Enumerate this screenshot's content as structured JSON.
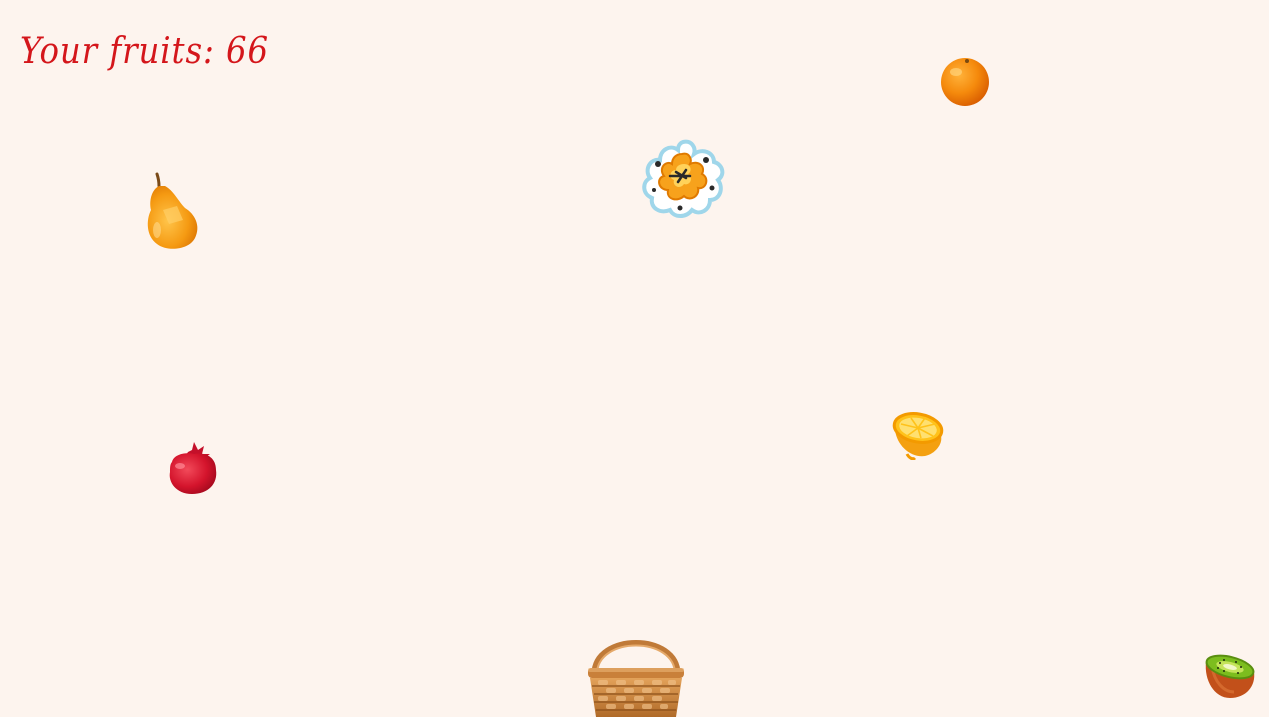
{
  "hud": {
    "score_label": "Your fruits:",
    "score_value": "66"
  },
  "sprites": [
    {
      "name": "orange-icon"
    },
    {
      "name": "pear-icon"
    },
    {
      "name": "explosion-icon"
    },
    {
      "name": "pomegranate-icon"
    },
    {
      "name": "lemon-half-icon"
    },
    {
      "name": "basket-icon"
    },
    {
      "name": "kiwi-half-icon"
    }
  ],
  "colors": {
    "background": "#fdf4ee",
    "score_text": "#d4161b"
  }
}
